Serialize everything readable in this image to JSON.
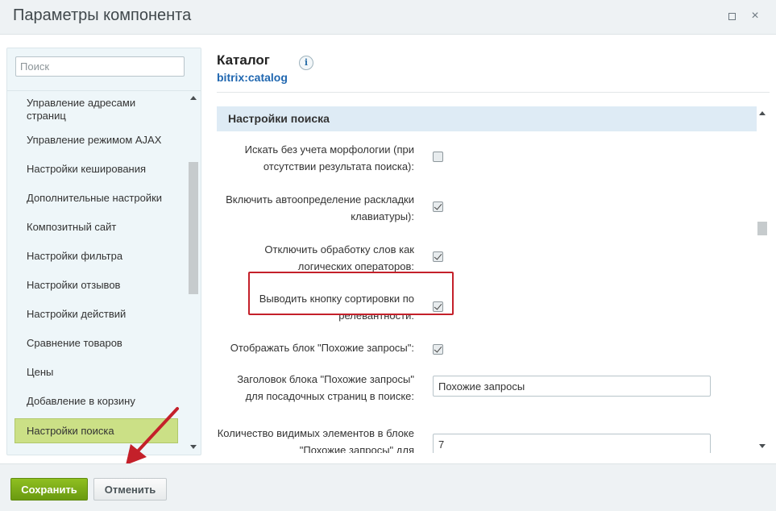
{
  "window": {
    "title": "Параметры компонента",
    "maximize_icon": "maximize-icon",
    "close_icon": "close-icon",
    "close_glyph": "×"
  },
  "sidebar": {
    "search_placeholder": "Поиск",
    "search_value": "",
    "items": [
      {
        "label": "Управление адресами страниц"
      },
      {
        "label": "Управление режимом AJAX"
      },
      {
        "label": "Настройки кеширования"
      },
      {
        "label": "Дополнительные настройки"
      },
      {
        "label": "Композитный сайт"
      },
      {
        "label": "Настройки фильтра"
      },
      {
        "label": "Настройки отзывов"
      },
      {
        "label": "Настройки действий"
      },
      {
        "label": "Сравнение товаров"
      },
      {
        "label": "Цены"
      },
      {
        "label": "Добавление в корзину"
      },
      {
        "label": "Настройки поиска",
        "active": true
      }
    ]
  },
  "component": {
    "title": "Каталог",
    "code": "bitrix:catalog",
    "info_icon": "info-icon",
    "info_glyph": "i"
  },
  "section": {
    "title": "Настройки поиска",
    "rows": [
      {
        "label": "Искать без учета морфологии (при отсутствии результата поиска):",
        "type": "checkbox",
        "checked": false
      },
      {
        "label": "Включить автоопределение раскладки клавиатуры):",
        "type": "checkbox",
        "checked": true
      },
      {
        "label": "Отключить обработку слов как логических операторов:",
        "type": "checkbox",
        "checked": true
      },
      {
        "label": "Выводить кнопку сортировки по релевантности:",
        "type": "checkbox",
        "checked": true,
        "highlighted": true
      },
      {
        "label": "Отображать блок \"Похожие запросы\":",
        "type": "checkbox",
        "checked": true
      },
      {
        "label": "Заголовок блока \"Похожие запросы\" для посадочных страниц в поиске:",
        "type": "text",
        "value": "Похожие запросы"
      },
      {
        "label": "Количество видимых элементов в блоке \"Похожие запросы\" для",
        "type": "text",
        "value": "7"
      }
    ]
  },
  "footer": {
    "save_label": "Сохранить",
    "cancel_label": "Отменить"
  },
  "colors": {
    "active_item_bg": "#cbe086",
    "section_header_bg": "#deebf5",
    "highlight_border": "#c4202a",
    "annotation_arrow": "#c4202a",
    "save_button": "#7aa817",
    "link_blue": "#2067b0"
  }
}
